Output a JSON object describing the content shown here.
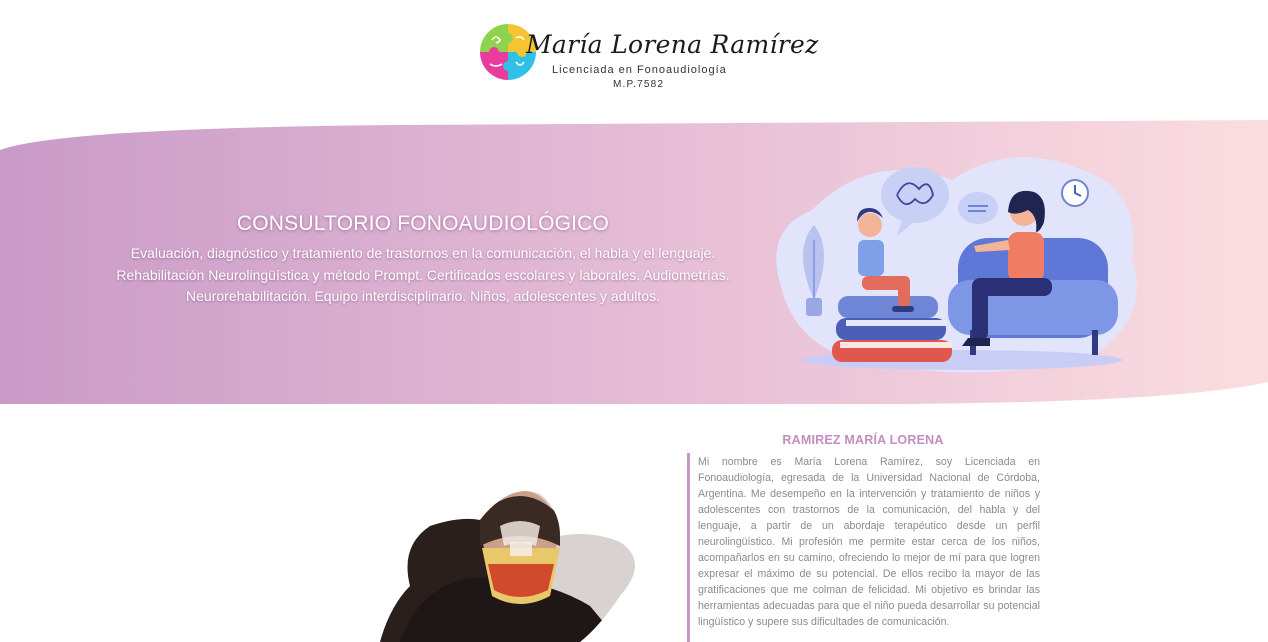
{
  "brand": {
    "name": "María Lorena Ramírez",
    "subtitle": "Licenciada en Fonoaudiología",
    "registration": "M.P.7582"
  },
  "colors": {
    "hero_gradient_start": "#c99ac8",
    "hero_gradient_end": "#fbdde0",
    "accent": "#c38dc3",
    "body_text": "#8b8b8b"
  },
  "hero": {
    "title": "CONSULTORIO FONOAUDIOLÓGICO",
    "lines": [
      "Evaluación, diagnóstico y tratamiento de trastornos en la comunicación, el habla y el lenguaje.",
      "Rehabilitación Neurolingüística y método Prompt. Certificados escolares y laborales. Audiometrías.",
      "Neurorehabilitación. Equipo interdisciplinario. Niños, adolescentes y adultos."
    ],
    "illustration": "therapist-child-session-illustration"
  },
  "bio": {
    "title": "RAMIREZ MARÍA LORENA",
    "text": "Mi nombre es María Lorena Ramírez, soy Licenciada en Fonoaudiología, egresada de la Universidad Nacional de Córdoba, Argentina. Me desempeño en la intervención y tratamiento de niños y adolescentes con trastornos de la comunicación, del habla y del lenguaje, a partir de un abordaje terapéutico desde un perfil neurolingüístico. Mi profesión me permite estar cerca de los niños, acompañarlos en su camino, ofreciendo lo mejor de mí para que logren expresar el máximo de su potencial. De ellos recibo la mayor de las gratificaciones que me colman de felicidad. Mi objetivo es brindar las herramientas adecuadas para que el niño pueda desarrollar su potencial lingüístico y supere sus dificultades de comunicación."
  },
  "photo": {
    "icon": "profile-photo-blob"
  }
}
